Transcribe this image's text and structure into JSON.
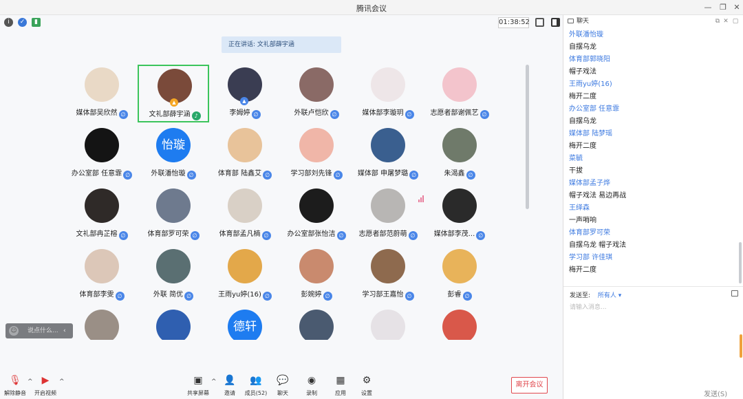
{
  "window": {
    "title": "腾讯会议"
  },
  "meeting": {
    "timer": "01:38:52",
    "speaking": "正在讲话: 文礼部薛宇涵",
    "say_placeholder": "说点什么...",
    "participants": [
      {
        "name": "媒体部吴欣然",
        "avatar": "photo",
        "color": "#e9d9c6",
        "mic": "muted"
      },
      {
        "name": "文礼部薛宇涵",
        "avatar": "photo",
        "color": "#7a4a3a",
        "mic": "on",
        "active": true,
        "badge": "host"
      },
      {
        "name": "李姆婷",
        "avatar": "photo",
        "color": "#3a3d52",
        "mic": "muted",
        "badge": "cohost"
      },
      {
        "name": "外联卢恺欣",
        "avatar": "photo",
        "color": "#8a6a66",
        "mic": "muted"
      },
      {
        "name": "媒体部李璇玥",
        "avatar": "photo",
        "color": "#eee6e8",
        "mic": "muted"
      },
      {
        "name": "志愿者部谢佩艺",
        "avatar": "photo",
        "color": "#f3c4cc",
        "mic": "muted"
      },
      {
        "name": "办公室部 任意霏",
        "avatar": "photo",
        "color": "#141414",
        "mic": "muted"
      },
      {
        "name": "外联潘怡璇",
        "avatar": "text",
        "initials": "怡璇",
        "color": "#1e7cf0",
        "mic": "muted"
      },
      {
        "name": "体育部 陆鑫艾",
        "avatar": "photo",
        "color": "#e8c39a",
        "mic": "muted"
      },
      {
        "name": "学习部刘先锋",
        "avatar": "photo",
        "color": "#f0b6a8",
        "mic": "muted"
      },
      {
        "name": "媒体部 申屠梦璐",
        "avatar": "photo",
        "color": "#3a5f8f",
        "mic": "muted"
      },
      {
        "name": "朱渴鑫",
        "avatar": "photo",
        "color": "#6f7a6a",
        "mic": "muted"
      },
      {
        "name": "文礼部冉芷榕",
        "avatar": "photo",
        "color": "#2f2a28",
        "mic": "muted"
      },
      {
        "name": "体育部罗可荣",
        "avatar": "photo",
        "color": "#6e7a8e",
        "mic": "muted"
      },
      {
        "name": "体育部孟凡楠",
        "avatar": "photo",
        "color": "#d9d0c6",
        "mic": "muted"
      },
      {
        "name": "办公室部张怡洁",
        "avatar": "photo",
        "color": "#1c1c1c",
        "mic": "muted"
      },
      {
        "name": "志愿者部范蔚萌",
        "avatar": "photo",
        "color": "#b8b6b4",
        "mic": "muted"
      },
      {
        "name": "媒体部李茂...",
        "avatar": "photo",
        "color": "#2a2a2a",
        "mic": "muted"
      },
      {
        "name": "体育部李雯",
        "avatar": "photo",
        "color": "#dcc7b8",
        "mic": "muted"
      },
      {
        "name": "外联 简优",
        "avatar": "photo",
        "color": "#5a6f72",
        "mic": "muted"
      },
      {
        "name": "王雨yu婷(16)",
        "avatar": "photo",
        "color": "#e3a84a",
        "mic": "muted"
      },
      {
        "name": "彭婉婷",
        "avatar": "photo",
        "color": "#c98a6e",
        "mic": "muted"
      },
      {
        "name": "学习部王嘉怡",
        "avatar": "photo",
        "color": "#8e6a4e",
        "mic": "muted"
      },
      {
        "name": "彭睿",
        "avatar": "photo",
        "color": "#e8b35a",
        "mic": "muted"
      },
      {
        "name": "",
        "avatar": "photo",
        "color": "#9a8f86",
        "mic": "none"
      },
      {
        "name": "",
        "avatar": "photo",
        "color": "#2f5fb0",
        "mic": "none"
      },
      {
        "name": "",
        "avatar": "text",
        "initials": "德轩",
        "color": "#1e7cf0",
        "mic": "none"
      },
      {
        "name": "",
        "avatar": "photo",
        "color": "#4a5a70",
        "mic": "none"
      },
      {
        "name": "",
        "avatar": "photo",
        "color": "#e6e2e6",
        "mic": "none"
      },
      {
        "name": "",
        "avatar": "photo",
        "color": "#d9584a",
        "mic": "none"
      }
    ]
  },
  "toolbar": {
    "unmute": "解除静音",
    "start_video": "开启视频",
    "share_screen": "共享屏幕",
    "invite": "邀请",
    "members": "成员(52)",
    "chat": "聊天",
    "record": "录制",
    "apps": "应用",
    "settings": "设置",
    "leave": "离开会议"
  },
  "chat": {
    "title": "聊天",
    "messages": [
      {
        "kind": "sender",
        "text": "外联潘怡璇"
      },
      {
        "kind": "text",
        "text": "自摆乌龙"
      },
      {
        "kind": "sender",
        "text": "体育部郭晓阳"
      },
      {
        "kind": "text",
        "text": "帽子戏法"
      },
      {
        "kind": "sender",
        "text": "王雨yu婷(16)"
      },
      {
        "kind": "text",
        "text": "梅开二度"
      },
      {
        "kind": "sender",
        "text": "办公室部 任意霏"
      },
      {
        "kind": "text",
        "text": "自摆乌龙"
      },
      {
        "kind": "sender",
        "text": "媒体部 陆梦瑶"
      },
      {
        "kind": "text",
        "text": "梅开二度"
      },
      {
        "kind": "sender",
        "text": "菜毓"
      },
      {
        "kind": "text",
        "text": "干拔"
      },
      {
        "kind": "sender",
        "text": "媒体部孟子烨"
      },
      {
        "kind": "text",
        "text": "帽子戏法 易边再战"
      },
      {
        "kind": "sender",
        "text": "王绎森"
      },
      {
        "kind": "text",
        "text": "一声哨响"
      },
      {
        "kind": "sender",
        "text": "体育部罗可荣"
      },
      {
        "kind": "text",
        "text": "自摆乌龙 帽子戏法"
      },
      {
        "kind": "sender",
        "text": "学习部 许佳琪"
      },
      {
        "kind": "text",
        "text": "梅开二度"
      }
    ],
    "send_to_label": "发送至:",
    "send_to_target": "所有人 ▾",
    "input_placeholder": "请输入消息...",
    "send_label": "发送(S)"
  }
}
